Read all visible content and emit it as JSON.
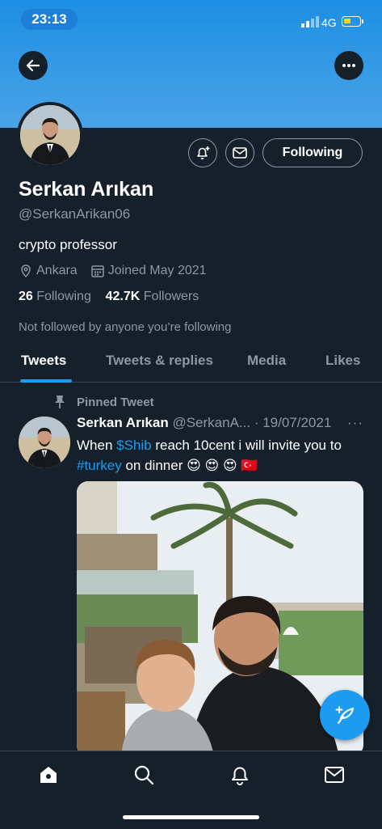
{
  "status_bar": {
    "time": "23:13",
    "network": "4G"
  },
  "icons": {
    "back": "arrow-left-icon",
    "more": "more-horizontal-icon",
    "notify": "bell-plus-icon",
    "message": "envelope-icon",
    "location": "location-pin-icon",
    "calendar": "calendar-icon",
    "pin": "pin-icon",
    "compose": "feather-plus-icon",
    "home": "home-icon",
    "search": "search-icon",
    "notifications": "bell-icon",
    "messages": "mail-icon"
  },
  "profile": {
    "name": "Serkan Arıkan",
    "handle": "@SerkanArikan06",
    "bio": "crypto professor",
    "location": "Ankara",
    "joined": "Joined May 2021",
    "following_count": "26",
    "following_label": "Following",
    "followers_count": "42.7K",
    "followers_label": "Followers",
    "not_followed": "Not followed by anyone you’re following",
    "follow_button": "Following"
  },
  "tabs": [
    {
      "label": "Tweets",
      "active": true
    },
    {
      "label": "Tweets & replies",
      "active": false
    },
    {
      "label": "Media",
      "active": false
    },
    {
      "label": "Likes",
      "active": false
    }
  ],
  "tweet": {
    "pinned_label": "Pinned Tweet",
    "author_name": "Serkan Arıkan",
    "author_handle": "@SerkanA...",
    "date": "· 19/07/2021",
    "more": "···",
    "text_1": "When ",
    "cashtag": "$Shib",
    "text_2": " reach 10cent i will invite you to ",
    "hashtag": "#turkey",
    "text_3": " on dinner 😍 😍 😍 🇹🇷"
  },
  "colors": {
    "background": "#15202b",
    "accent": "#1d9bf0",
    "muted": "#8b98a5",
    "banner": "#4aa3e6"
  }
}
